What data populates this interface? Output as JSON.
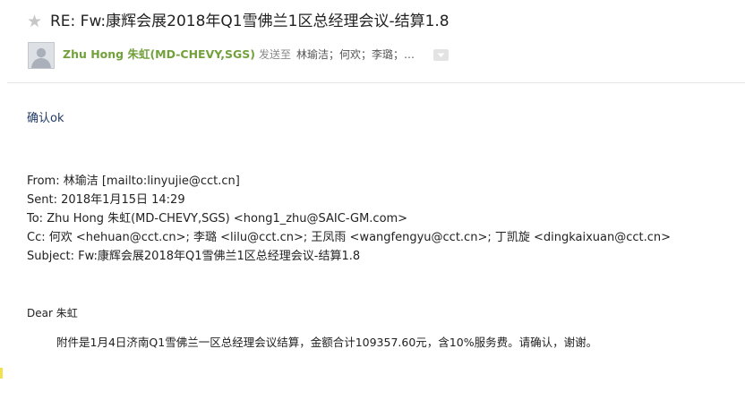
{
  "email": {
    "subject": "RE: Fw:康辉会展2018年Q1雪佛兰1区总经理会议-结算1.8",
    "sender": "Zhu Hong 朱虹(MD-CHEVY,SGS)",
    "to_label": "发送至",
    "to_names": "林瑜洁；何欢；李璐；…",
    "icons": {
      "star": "star-icon",
      "avatar": "user-avatar-icon",
      "expand": "chevron-down-icon"
    }
  },
  "body": {
    "reply": "确认ok",
    "quoted": {
      "from_label": "From:",
      "from_value": " 林瑜洁 [mailto:linyujie@cct.cn]",
      "sent_label": "Sent:",
      "sent_value": " 2018年1月15日 14:29",
      "to_label": "To:",
      "to_value": " Zhu Hong 朱虹(MD-CHEVY,SGS) <hong1_zhu@SAIC-GM.com>",
      "cc_label": "Cc:",
      "cc_value": " 何欢 <hehuan@cct.cn>; 李璐 <lilu@cct.cn>; 王凤雨 <wangfengyu@cct.cn>; 丁凯旋 <dingkaixuan@cct.cn>",
      "subject_label": "Subject:",
      "subject_value": " Fw:康辉会展2018年Q1雪佛兰1区总经理会议-结算1.8"
    },
    "greeting": "Dear 朱虹",
    "paragraph": "附件是1月4日济南Q1雪佛兰一区总经理会议结算，金额合计109357.60元，含10%服务费。请确认，谢谢。"
  }
}
